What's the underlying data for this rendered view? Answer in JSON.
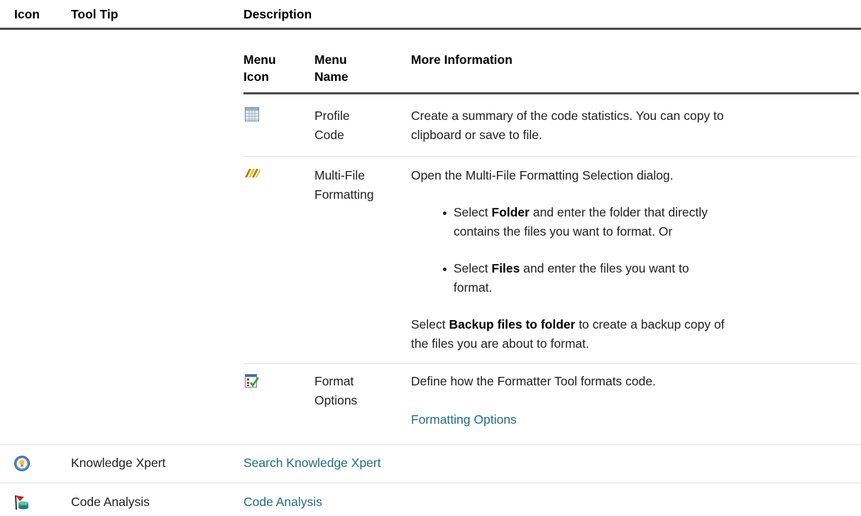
{
  "outer_headers": {
    "icon": "Icon",
    "tooltip": "Tool Tip",
    "description": "Description"
  },
  "inner_headers": {
    "menu_icon_1": "Menu",
    "menu_icon_2": "Icon",
    "menu_name_1": "Menu",
    "menu_name_2": "Name",
    "more_info": "More Information"
  },
  "inner_rows": [
    {
      "icon": "table-grid-icon",
      "name_lines": [
        "Profile",
        "Code"
      ],
      "info_lines": [
        "Create a summary of the code statistics. You can copy to",
        "clipboard or save to file."
      ]
    },
    {
      "icon": "double-arrow-icon",
      "name_lines": [
        "Multi-File",
        "Formatting"
      ],
      "intro": "Open the Multi-File Formatting Selection dialog.",
      "bullet1": {
        "pre": "Select ",
        "bold": "Folder",
        "post": " and enter the folder that directly",
        "line2": "contains the files you want to format. Or"
      },
      "bullet2": {
        "pre": "Select ",
        "bold": "Files",
        "post": " and enter the files you want to",
        "line2": "format."
      },
      "outro": {
        "pre": "Select ",
        "bold": "Backup files to folder",
        "post": " to create a backup copy of",
        "line2": "the files you are about to format."
      }
    },
    {
      "icon": "checklist-icon",
      "name_lines": [
        "Format",
        "Options"
      ],
      "info": "Define how the Formatter Tool formats code.",
      "link": "Formatting Options"
    }
  ],
  "outer_rows": [
    {
      "icon": "lightbulb-icon",
      "tooltip": "Knowledge Xpert",
      "link": "Search Knowledge Xpert"
    },
    {
      "icon": "code-analysis-icon",
      "tooltip": "Code Analysis",
      "link": "Code Analysis"
    }
  ],
  "colors": {
    "link": "#1f6c85",
    "rule_dark": "#4a4a4a",
    "rule_light": "#e0e0e0"
  }
}
